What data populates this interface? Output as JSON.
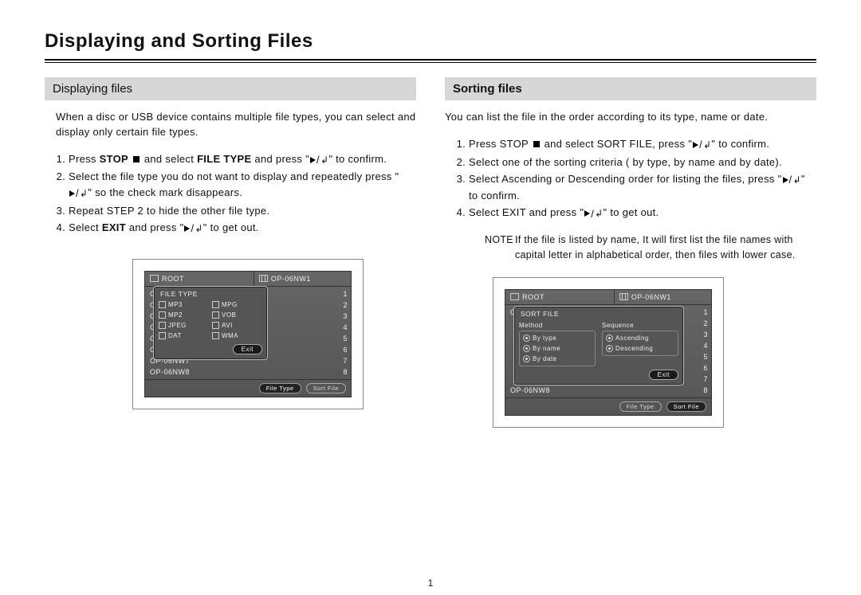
{
  "page_title": "Displaying and Sorting Files",
  "page_number": "1",
  "left": {
    "heading": "Displaying files",
    "intro": "When a disc or USB device contains multiple file types,  you can select and display only certain file types.",
    "steps": {
      "s1a": "Press ",
      "s1_stop": "STOP",
      "s1b": " and select ",
      "s1_ft": "FILE TYPE",
      "s1c": " and press \"",
      "s1d": "\" to confirm.",
      "s2a": "Select the file type you do not want to display and repeatedly press \"",
      "s2b": "\" so the check mark disappears.",
      "s3": "Repeat STEP 2 to hide the other file type.",
      "s4a": "Select ",
      "s4_exit": "EXIT",
      "s4b": " and press \"",
      "s4c": "\" to get out."
    },
    "osd": {
      "root": "ROOT",
      "file_prefix": "OP-06NW",
      "files": [
        "OP-06NW1",
        "OP-06NW2",
        "OP-06NW3",
        "OP-06NW4",
        "OP-06NW5",
        "OP-06NW6",
        "OP-06NW7",
        "OP-06NW8"
      ],
      "nums": [
        "1",
        "2",
        "3",
        "4",
        "5",
        "6",
        "7",
        "8"
      ],
      "overlay_title": "FILE TYPE",
      "types": [
        "MP3",
        "MPG",
        "MP2",
        "VOB",
        "JPEG",
        "AVI",
        "DAT",
        "WMA"
      ],
      "exit": "Exit",
      "bottom_file_type": "File Type",
      "bottom_sort_file": "Sort File"
    }
  },
  "right": {
    "heading": "Sorting files",
    "intro": "You can list the file in the order according to its type, name or date.",
    "steps": {
      "s1a": "Press STOP ",
      "s1b": " and select SORT FILE, press \"",
      "s1c": "\" to confirm.",
      "s2": "Select one of the sorting criteria ( by type, by name and by date).",
      "s3a": "Select Ascending or Descending order for listing the files, press \"",
      "s3b": "\" to confirm.",
      "s4a": "Select EXIT and press \"",
      "s4b": "\" to get out."
    },
    "note_label": "NOTE",
    "note_text": "If the file is listed by name, It will first list the file names with capital letter in alphabetical order, then files with lower case.",
    "osd": {
      "root": "ROOT",
      "files": [
        "OP-06NW1",
        "",
        "",
        "",
        "",
        "",
        "",
        "OP-06NW8"
      ],
      "nums": [
        "1",
        "2",
        "3",
        "4",
        "5",
        "6",
        "7",
        "8"
      ],
      "overlay_title": "SORT FILE",
      "method_label": "Method",
      "sequence_label": "Sequence",
      "methods": [
        "By type",
        "By name",
        "By date"
      ],
      "sequences": [
        "Ascending",
        "Descending"
      ],
      "exit": "Exit",
      "bottom_file_type": "File Type",
      "bottom_sort_file": "Sort File"
    }
  }
}
